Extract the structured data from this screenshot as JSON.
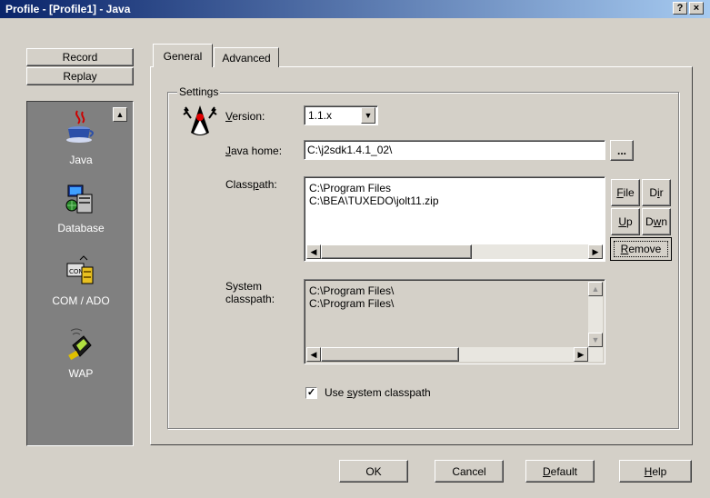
{
  "window": {
    "title": "Profile - [Profile1] - Java",
    "help_button": "?",
    "close_button": "×"
  },
  "sidebar": {
    "record_label": "Record",
    "replay_label": "Replay",
    "items": [
      {
        "label": "Java"
      },
      {
        "label": "Database"
      },
      {
        "label": "COM / ADO"
      },
      {
        "label": "WAP"
      }
    ],
    "scroll_up": "▲"
  },
  "tabs": [
    {
      "label": "General",
      "active": true
    },
    {
      "label": "Advanced",
      "active": false
    }
  ],
  "settings": {
    "group_title": "Settings",
    "version_label_pre": "",
    "version_label_u": "V",
    "version_label_post": "ersion:",
    "version_value": "1.1.x",
    "javahome_label_u": "J",
    "javahome_label_post": "ava home:",
    "javahome_value": "C:\\j2sdk1.4.1_02\\",
    "browse_label": "...",
    "classpath_label_pre": "Class",
    "classpath_label_u": "p",
    "classpath_label_post": "ath:",
    "classpath_items": [
      "C:\\Program Files",
      "C:\\BEA\\TUXEDO\\jolt11.zip"
    ],
    "file_btn_u": "F",
    "file_btn_post": "ile",
    "dir_btn_pre": "D",
    "dir_btn_u": "i",
    "dir_btn_post": "r",
    "up_btn_u": "U",
    "up_btn_post": "p",
    "dwn_btn_pre": "D",
    "dwn_btn_u": "w",
    "dwn_btn_post": "n",
    "remove_btn_u": "R",
    "remove_btn_post": "emove",
    "system_label_line1": "System",
    "system_label_line2": "classpath:",
    "system_items": [
      "C:\\Program Files\\",
      "C:\\Program Files\\"
    ],
    "use_system_checked": true,
    "use_system_pre": "Use ",
    "use_system_u": "s",
    "use_system_post": "ystem classpath"
  },
  "footer": {
    "ok_label": "OK",
    "cancel_label": "Cancel",
    "default_u": "D",
    "default_post": "efault",
    "help_u": "H",
    "help_post": "elp"
  }
}
